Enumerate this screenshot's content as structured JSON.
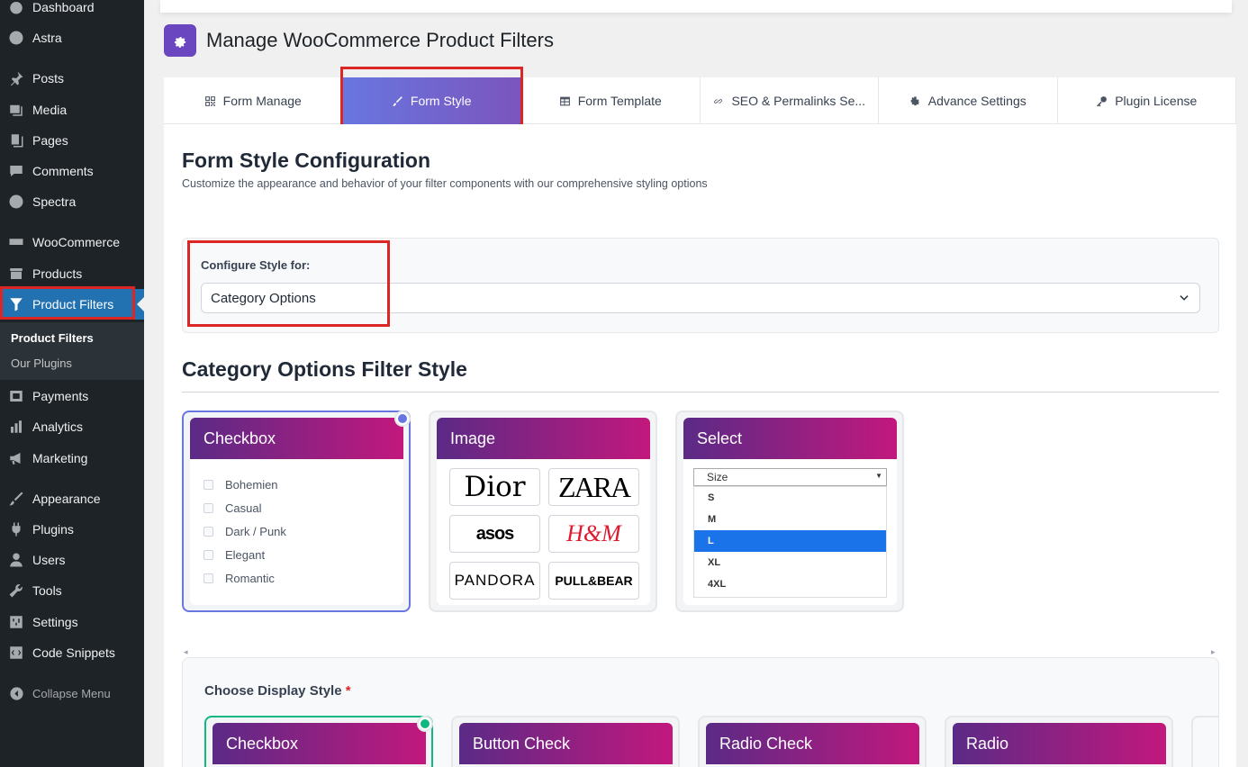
{
  "sidebar": {
    "items": [
      {
        "label": "Dashboard",
        "icon": "dashboard-icon"
      },
      {
        "label": "Astra",
        "icon": "astra-icon"
      },
      {
        "label": "Posts",
        "icon": "pin-icon"
      },
      {
        "label": "Media",
        "icon": "media-icon"
      },
      {
        "label": "Pages",
        "icon": "pages-icon"
      },
      {
        "label": "Comments",
        "icon": "comment-icon"
      },
      {
        "label": "Spectra",
        "icon": "spectra-icon"
      },
      {
        "label": "WooCommerce",
        "icon": "woocommerce-icon"
      },
      {
        "label": "Products",
        "icon": "archive-icon"
      },
      {
        "label": "Product Filters",
        "icon": "filter-icon"
      },
      {
        "label": "Payments",
        "icon": "payment-icon"
      },
      {
        "label": "Analytics",
        "icon": "bar-chart-icon"
      },
      {
        "label": "Marketing",
        "icon": "megaphone-icon"
      },
      {
        "label": "Appearance",
        "icon": "brush-icon"
      },
      {
        "label": "Plugins",
        "icon": "plug-icon"
      },
      {
        "label": "Users",
        "icon": "user-icon"
      },
      {
        "label": "Tools",
        "icon": "wrench-icon"
      },
      {
        "label": "Settings",
        "icon": "sliders-icon"
      },
      {
        "label": "Code Snippets",
        "icon": "code-icon"
      }
    ],
    "submenu": [
      "Product Filters",
      "Our Plugins"
    ],
    "collapse": "Collapse Menu"
  },
  "header": {
    "title": "Manage WooCommerce Product Filters",
    "icon": "gear-cog-icon"
  },
  "tabs": [
    {
      "label": "Form Manage",
      "icon": "qr-grid-icon"
    },
    {
      "label": "Form Style",
      "icon": "brush-icon"
    },
    {
      "label": "Form Template",
      "icon": "table-icon"
    },
    {
      "label": "SEO & Permalinks Se...",
      "icon": "link-icon"
    },
    {
      "label": "Advance Settings",
      "icon": "gear-icon"
    },
    {
      "label": "Plugin License",
      "icon": "key-icon"
    }
  ],
  "section": {
    "title": "Form Style Configuration",
    "subtitle": "Customize the appearance and behavior of your filter components with our comprehensive styling options"
  },
  "config": {
    "label": "Configure Style for:",
    "value": "Category Options"
  },
  "filter_style": {
    "title": "Category Options Filter Style",
    "cards": [
      {
        "title": "Checkbox",
        "options": [
          "Bohemien",
          "Casual",
          "Dark / Punk",
          "Elegant",
          "Romantic"
        ]
      },
      {
        "title": "Image",
        "brands": [
          "Dior",
          "ZARA",
          "asos",
          "H&M",
          "PANDORA",
          "PULL&BEAR"
        ]
      },
      {
        "title": "Select",
        "placeholder": "Size",
        "options": [
          "S",
          "M",
          "L",
          "XL",
          "4XL"
        ],
        "highlighted": "L"
      }
    ]
  },
  "display_style": {
    "label": "Choose Display Style",
    "required_mark": "*",
    "cards": [
      "Checkbox",
      "Button Check",
      "Radio Check",
      "Radio"
    ]
  },
  "scroll": {
    "left": "◂",
    "right": "▸"
  },
  "colors": {
    "accent": "#6876e0",
    "brand_grad_start": "#5b2a86",
    "brand_grad_end": "#c2187d",
    "wp_active": "#2271b1",
    "highlight": "#dc2626"
  }
}
